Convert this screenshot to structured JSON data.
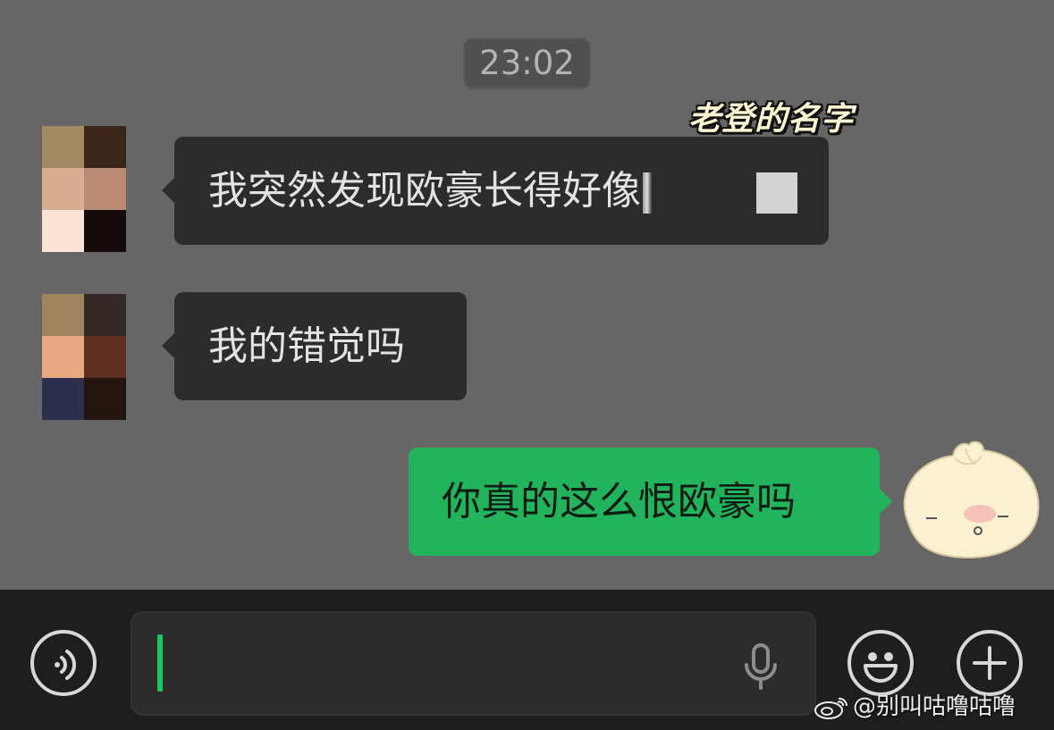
{
  "chat": {
    "timestamp": "23:02",
    "annotation": "老登的名字",
    "messages": [
      {
        "sender": "other",
        "text": "我突然发现欧豪长得好像"
      },
      {
        "sender": "other",
        "text": "我的错觉吗"
      },
      {
        "sender": "self",
        "text": "你真的这么恨欧豪吗"
      }
    ],
    "avatar1_colors": [
      "#a38a65",
      "#3b261a",
      "#d8ad92",
      "#bb8b76",
      "#fde2d6",
      "#150b0c"
    ],
    "avatar2_colors": [
      "#9f845f",
      "#342927",
      "#e9a982",
      "#5d3021",
      "#2c304c",
      "#221510"
    ]
  },
  "input_bar": {
    "voice_icon": "voice-wave-icon",
    "mic_icon": "microphone-icon",
    "emoji_icon": "smiley-icon",
    "plus_icon": "plus-icon",
    "cursor_color": "#1fc464"
  },
  "colors": {
    "bubble_in": "#2c2c2c",
    "bubble_out": "#21b45d",
    "background": "#666666"
  },
  "watermark": {
    "handle": "@别叫咕噜咕噜",
    "icon": "weibo-icon"
  }
}
